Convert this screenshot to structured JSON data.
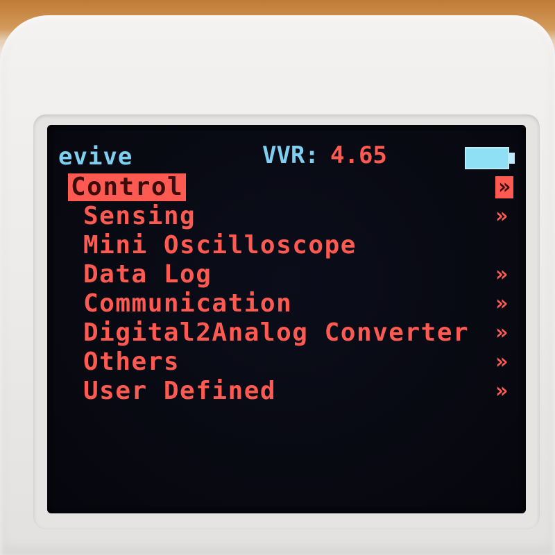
{
  "device": {
    "brand": "evive",
    "vvr_label": "VVR:",
    "vvr_value": "4.65",
    "battery_icon": "battery-full-icon",
    "colors": {
      "header_text": "#7fd0f0",
      "menu_text": "#ff5a52",
      "screen_bg": "#07080f",
      "battery": "#8fe0f4"
    }
  },
  "menu": {
    "arrow_glyph": "»",
    "items": [
      {
        "label": "Control",
        "has_submenu": true,
        "selected": true
      },
      {
        "label": "Sensing",
        "has_submenu": true,
        "selected": false
      },
      {
        "label": "Mini Oscilloscope",
        "has_submenu": false,
        "selected": false
      },
      {
        "label": "Data Log",
        "has_submenu": true,
        "selected": false
      },
      {
        "label": "Communication",
        "has_submenu": true,
        "selected": false
      },
      {
        "label": "Digital2Analog Converter",
        "has_submenu": true,
        "selected": false
      },
      {
        "label": "Others",
        "has_submenu": true,
        "selected": false
      },
      {
        "label": "User Defined",
        "has_submenu": true,
        "selected": false
      }
    ]
  }
}
